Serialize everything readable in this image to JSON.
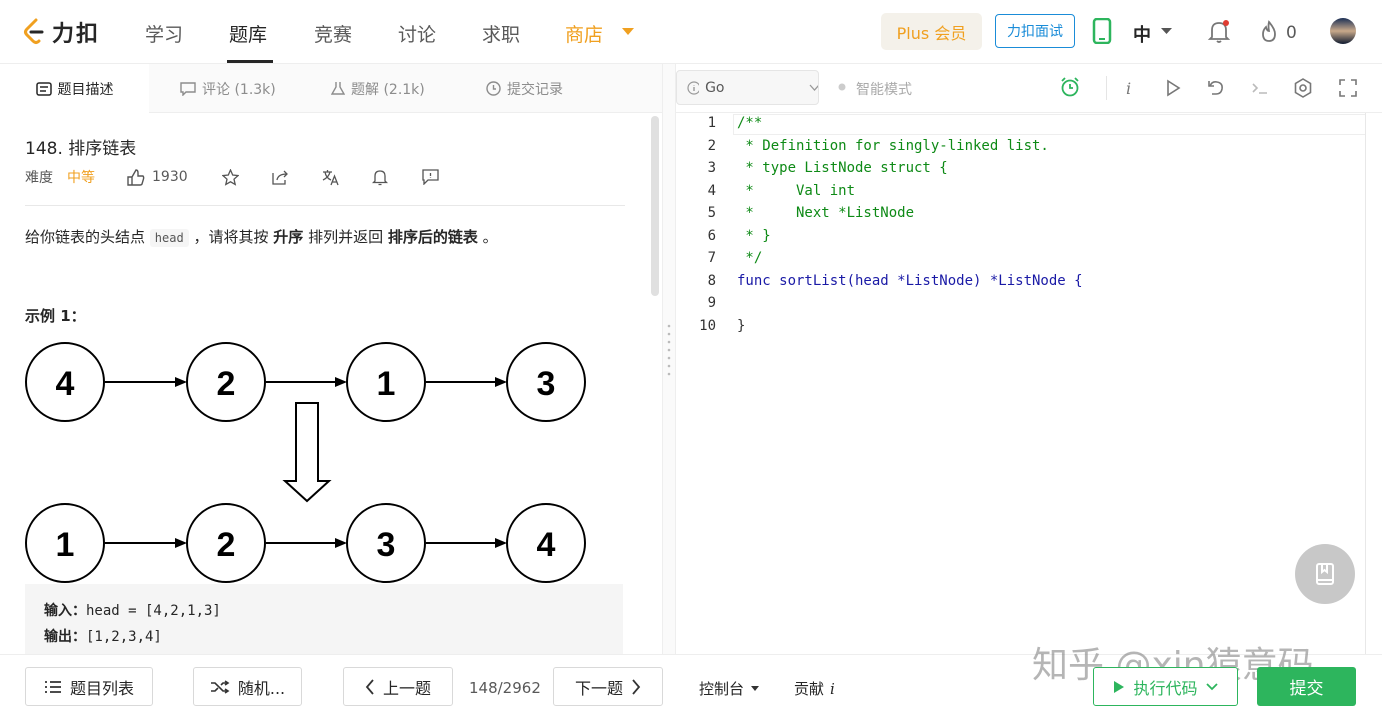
{
  "brand": {
    "name": "力扣"
  },
  "nav": {
    "study": "学习",
    "problems": "题库",
    "contest": "竞赛",
    "discuss": "讨论",
    "jobs": "求职",
    "store": "商店"
  },
  "header": {
    "plus": "Plus 会员",
    "interview": "力扣面试",
    "lang": "中",
    "notifications_count": "0"
  },
  "tabs": {
    "description": "题目描述",
    "comments": "评论 (1.3k)",
    "solutions": "题解 (2.1k)",
    "submissions": "提交记录"
  },
  "editor_toolbar": {
    "language": "Go",
    "mode": "智能模式"
  },
  "problem": {
    "title": "148. 排序链表",
    "difficulty_label": "难度",
    "difficulty": "中等",
    "likes": "1930",
    "desc_prefix": "给你链表的头结点",
    "desc_code": "head",
    "desc_mid": "，请将其按",
    "desc_bold1": "升序",
    "desc_mid2": "排列并返回",
    "desc_bold2": "排序后的链表",
    "desc_end": "。",
    "example_title": "示例 1：",
    "diagram_top": [
      "4",
      "2",
      "1",
      "3"
    ],
    "diagram_bottom": [
      "1",
      "2",
      "3",
      "4"
    ],
    "input_label": "输入：",
    "input_value": "head = [4,2,1,3]",
    "output_label": "输出：",
    "output_value": "[1,2,3,4]"
  },
  "code": {
    "line_numbers": [
      "1",
      "2",
      "3",
      "4",
      "5",
      "6",
      "7",
      "8",
      "9",
      "10"
    ],
    "lines": [
      "/**",
      " * Definition for singly-linked list.",
      " * type ListNode struct {",
      " *     Val int",
      " *     Next *ListNode",
      " * }",
      " */",
      "func sortList(head *ListNode) *ListNode {",
      "",
      "}"
    ],
    "comment_color": "#0e8a16",
    "keyword_color": "#1a1aa6"
  },
  "footer": {
    "problem_list": "题目列表",
    "random": "随机...",
    "prev": "上一题",
    "progress": "148/2962",
    "next": "下一题",
    "console": "控制台",
    "contribute": "贡献",
    "run": "执行代码",
    "submit": "提交"
  },
  "watermark": "知乎 @xin猿意码",
  "colors": {
    "accent_orange": "#f0a020",
    "accent_green": "#2db55d",
    "accent_blue": "#1a8cd8"
  }
}
